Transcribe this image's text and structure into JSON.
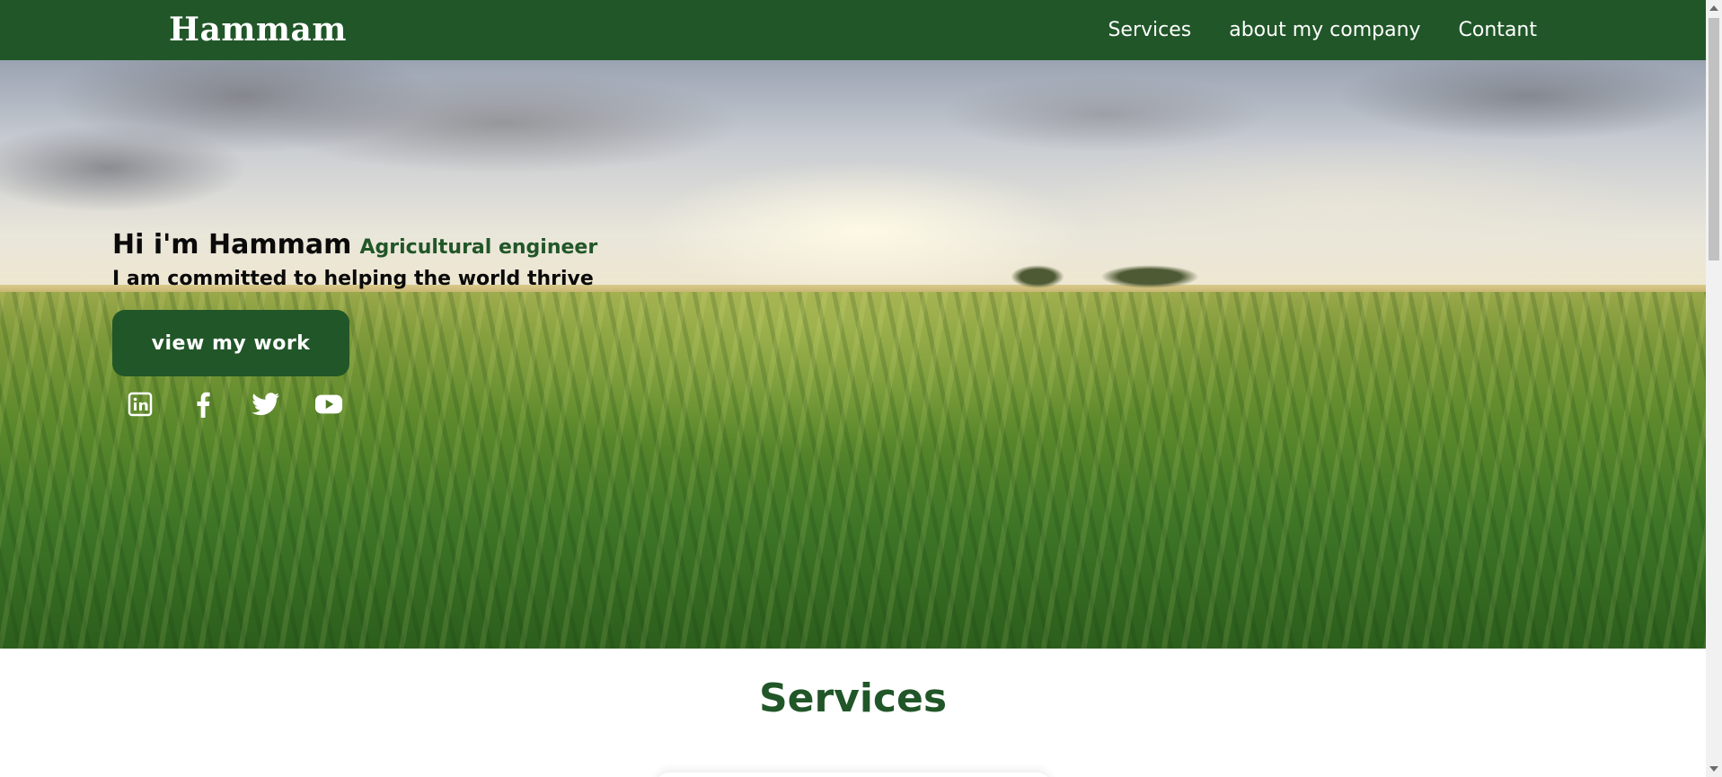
{
  "navbar": {
    "brand": "Hammam",
    "links": [
      {
        "label": "Services"
      },
      {
        "label": "about my company"
      },
      {
        "label": "Contant"
      }
    ],
    "background": "#215628"
  },
  "hero": {
    "greeting": "Hi i'm Hammam",
    "role": "Agricultural engineer",
    "tagline": "I am committed to helping the world thrive",
    "cta_label": "view my work",
    "socials": [
      {
        "icon": "linkedin-icon"
      },
      {
        "icon": "facebook-icon"
      },
      {
        "icon": "twitter-icon"
      },
      {
        "icon": "youtube-icon"
      }
    ]
  },
  "services": {
    "title": "Services"
  },
  "colors": {
    "accent": "#215628",
    "text": "#0a0a0a"
  }
}
